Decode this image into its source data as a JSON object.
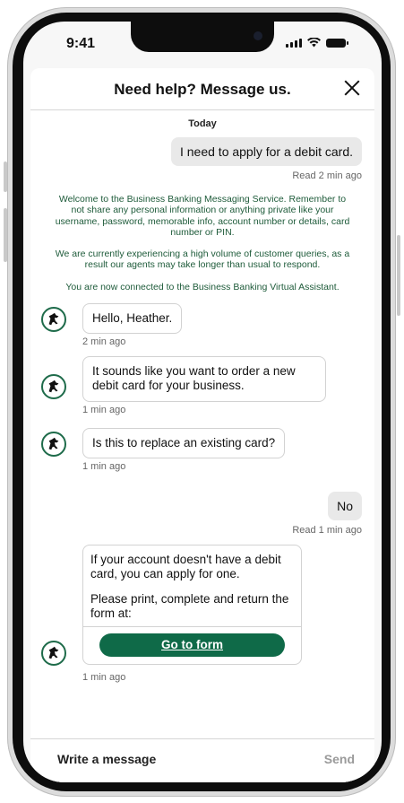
{
  "status": {
    "time": "9:41"
  },
  "header": {
    "title": "Need help? Message us."
  },
  "chat": {
    "date": "Today",
    "user_msg_1": {
      "text": "I need to apply for a debit card.",
      "receipt": "Read  2 min ago"
    },
    "system": {
      "p1": "Welcome to the Business Banking Messaging Service. Remember to not share any personal information or anything private like your username, password, memorable info, account number or details, card number or PIN.",
      "p2": "We are currently experiencing a high volume of customer queries, as a result our agents may take longer than usual to respond.",
      "p3": "You are now connected to the Business Banking Virtual Assistant."
    },
    "bot_msg_1": {
      "text": "Hello, Heather.",
      "time": "2 min ago"
    },
    "bot_msg_2": {
      "text": "It sounds like you want to order a new debit card for your business.",
      "time": "1 min ago"
    },
    "bot_msg_3": {
      "text": "Is this to replace an existing card?",
      "time": "1 min ago"
    },
    "user_msg_2": {
      "text": "No",
      "receipt": "Read  1 min ago"
    },
    "bot_card": {
      "p1": "If your account doesn't have a debit card, you can apply for one.",
      "p2": "Please print, complete and return the form at:",
      "button": "Go to form",
      "time": "1 min ago"
    }
  },
  "composer": {
    "placeholder": "Write a message",
    "send": "Send"
  },
  "colors": {
    "brand_green": "#0f6a48",
    "system_text": "#1e5b3a"
  },
  "icons": {
    "avatar": "black-horse-icon",
    "close": "close-icon"
  }
}
